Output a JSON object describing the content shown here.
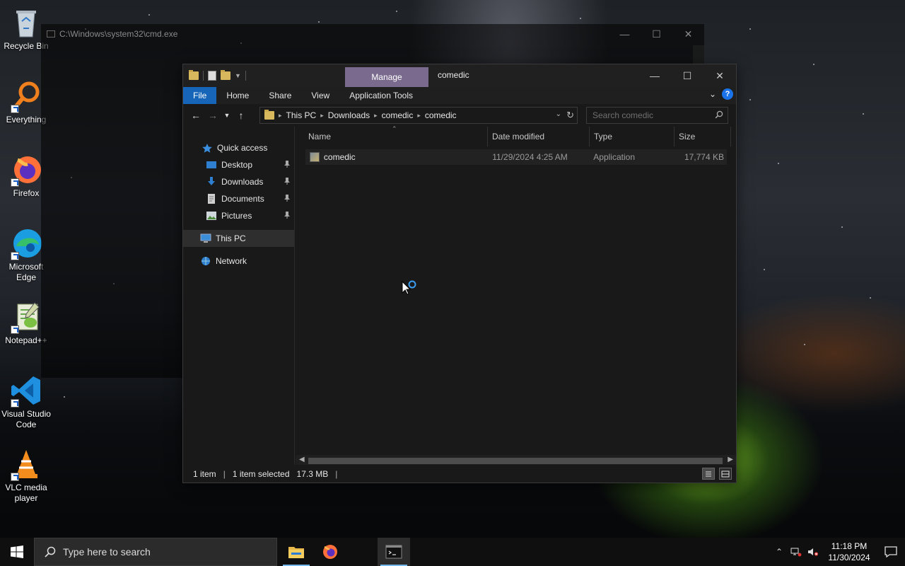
{
  "desktop": {
    "icons": [
      {
        "label": "Recycle Bin"
      },
      {
        "label": "Everything"
      },
      {
        "label": "Firefox"
      },
      {
        "label": "Microsoft Edge"
      },
      {
        "label": "Notepad++"
      },
      {
        "label": "Visual Studio Code"
      },
      {
        "label": "VLC media player"
      }
    ]
  },
  "cmd": {
    "title": "C:\\Windows\\system32\\cmd.exe"
  },
  "explorer": {
    "manage_tab": "Manage",
    "title": "comedic",
    "ribbon_tabs": [
      "File",
      "Home",
      "Share",
      "View",
      "Application Tools"
    ],
    "breadcrumb": [
      "This PC",
      "Downloads",
      "comedic",
      "comedic"
    ],
    "search_placeholder": "Search comedic",
    "nav": {
      "quick_access": "Quick access",
      "desktop": "Desktop",
      "downloads": "Downloads",
      "documents": "Documents",
      "pictures": "Pictures",
      "this_pc": "This PC",
      "network": "Network"
    },
    "columns": [
      "Name",
      "Date modified",
      "Type",
      "Size"
    ],
    "files": [
      {
        "name": "comedic",
        "date": "11/29/2024 4:25 AM",
        "type": "Application",
        "size": "17,774 KB"
      }
    ],
    "status": {
      "count": "1 item",
      "selected": "1 item selected",
      "size": "17.3 MB"
    }
  },
  "taskbar": {
    "search_placeholder": "Type here to search",
    "time": "11:18 PM",
    "date": "11/30/2024"
  },
  "colors": {
    "accent": "#1665b8",
    "manage_tab": "#7a6a8e"
  }
}
